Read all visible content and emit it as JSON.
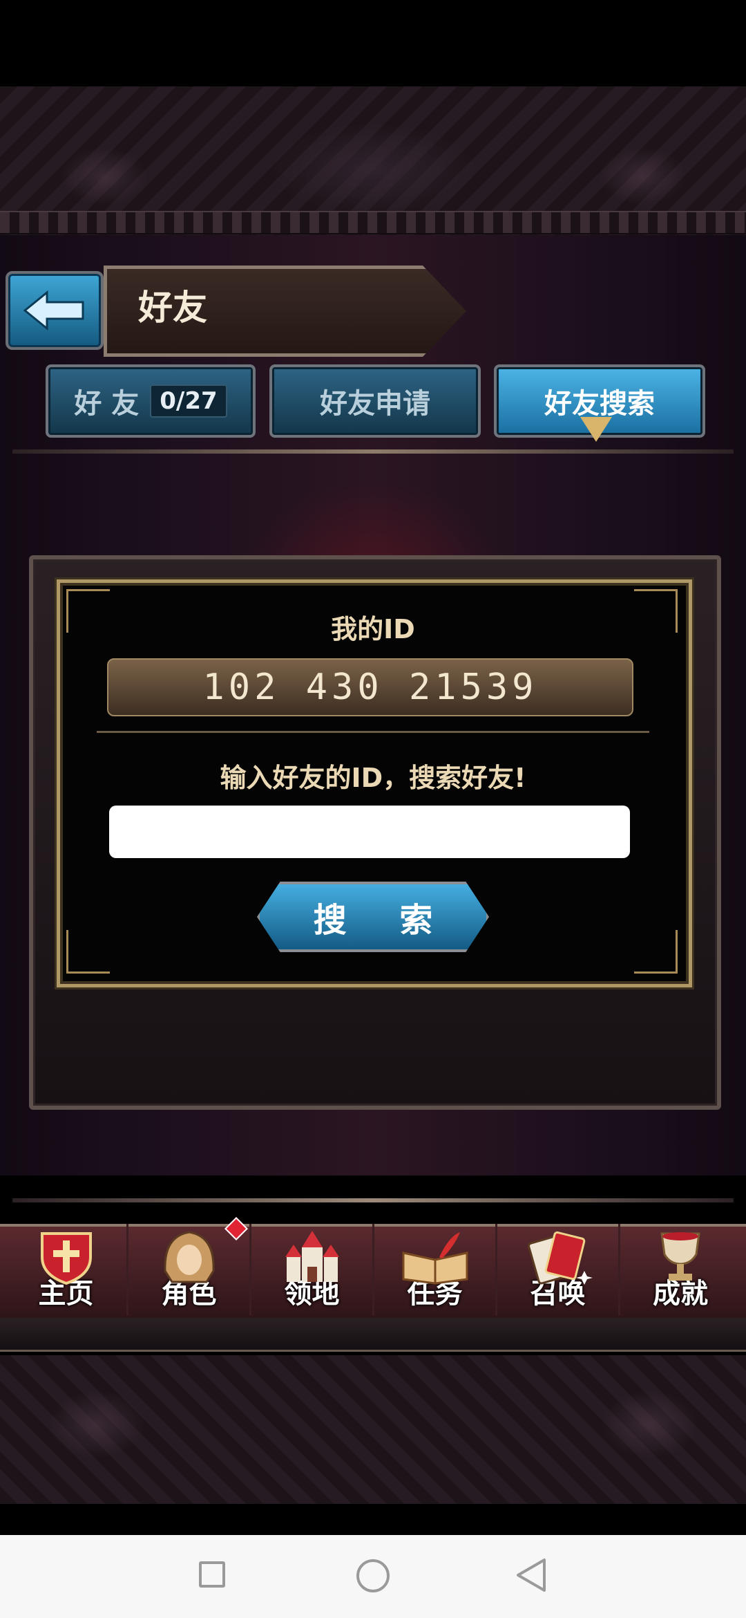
{
  "header": {
    "title": "好友"
  },
  "tabs": [
    {
      "label": "好 友",
      "count": "0/27",
      "active": false
    },
    {
      "label": "好友申请",
      "active": false
    },
    {
      "label": "好友搜索",
      "active": true
    }
  ],
  "search_panel": {
    "my_id_label": "我的ID",
    "my_id_value": "102  430  21539",
    "hint": "输入好友的ID，搜索好友!",
    "input_value": "",
    "search_button": "搜 索"
  },
  "bottom_nav": [
    {
      "label": "主页",
      "icon": "shield-cross-icon"
    },
    {
      "label": "角色",
      "icon": "hooded-character-icon",
      "badge": true
    },
    {
      "label": "领地",
      "icon": "castle-icon"
    },
    {
      "label": "任务",
      "icon": "book-quill-icon"
    },
    {
      "label": "召唤",
      "icon": "cards-icon"
    },
    {
      "label": "成就",
      "icon": "trophy-icon"
    }
  ],
  "colors": {
    "tab_active": "#2f8fc4",
    "tab_inactive": "#1f4d68",
    "gold_text": "#ead9b4",
    "badge_red": "#e02433"
  }
}
